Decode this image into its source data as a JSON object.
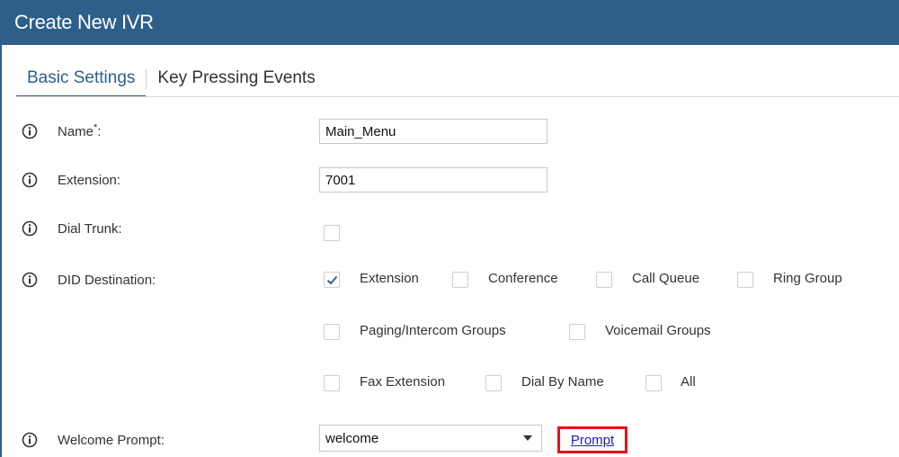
{
  "window": {
    "title": "Create New IVR"
  },
  "tabs": [
    {
      "label": "Basic Settings",
      "active": true
    },
    {
      "label": "Key Pressing Events",
      "active": false
    }
  ],
  "fields": {
    "name": {
      "label": "Name",
      "required_mark": "*",
      "suffix": ":",
      "value": "Main_Menu"
    },
    "extension": {
      "label": "Extension:",
      "value": "7001"
    },
    "dial_trunk": {
      "label": "Dial Trunk:",
      "checked": false
    },
    "did_destination": {
      "label": "DID Destination:",
      "options": [
        {
          "label": "Extension",
          "checked": true
        },
        {
          "label": "Conference",
          "checked": false
        },
        {
          "label": "Call Queue",
          "checked": false
        },
        {
          "label": "Ring Group",
          "checked": false
        },
        {
          "label": "Paging/Intercom Groups",
          "checked": false
        },
        {
          "label": "Voicemail Groups",
          "checked": false
        },
        {
          "label": "Fax Extension",
          "checked": false
        },
        {
          "label": "Dial By Name",
          "checked": false
        },
        {
          "label": "All",
          "checked": false
        }
      ]
    },
    "welcome_prompt": {
      "label": "Welcome Prompt:",
      "value": "welcome",
      "link_label": "Prompt"
    }
  },
  "icons": {
    "info": "info-circle-icon",
    "check": "checkmark-icon",
    "dropdown": "triangle-down-icon"
  },
  "colors": {
    "header": "#2d5f8a",
    "link": "#1a1adb",
    "highlight": "#e0141e",
    "check": "#2d5f8a"
  }
}
